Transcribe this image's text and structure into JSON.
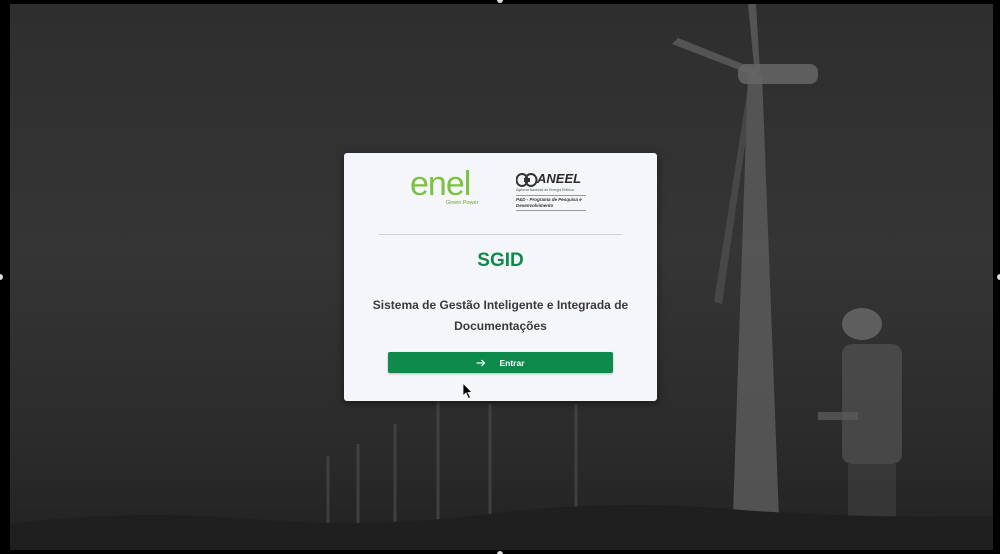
{
  "background": {
    "description_icon": "wind-turbine-landscape"
  },
  "card": {
    "logos": {
      "enel": {
        "word": "enel",
        "tagline": "Green Power"
      },
      "aneel": {
        "name": "ANEEL",
        "agency": "Agência Nacional de Energia Elétrica",
        "program": "P&D - Programa de Pesquisa e Desenvolvimento"
      }
    },
    "title": "SGID",
    "subtitle": "Sistema de Gestão Inteligente e Integrada de Documentações",
    "button": {
      "label": "Entrar",
      "icon": "arrow-right-icon"
    }
  },
  "colors": {
    "brand_green": "#0e8a4c",
    "enel_green": "#7cc242",
    "card_bg": "#f5f6f9"
  }
}
